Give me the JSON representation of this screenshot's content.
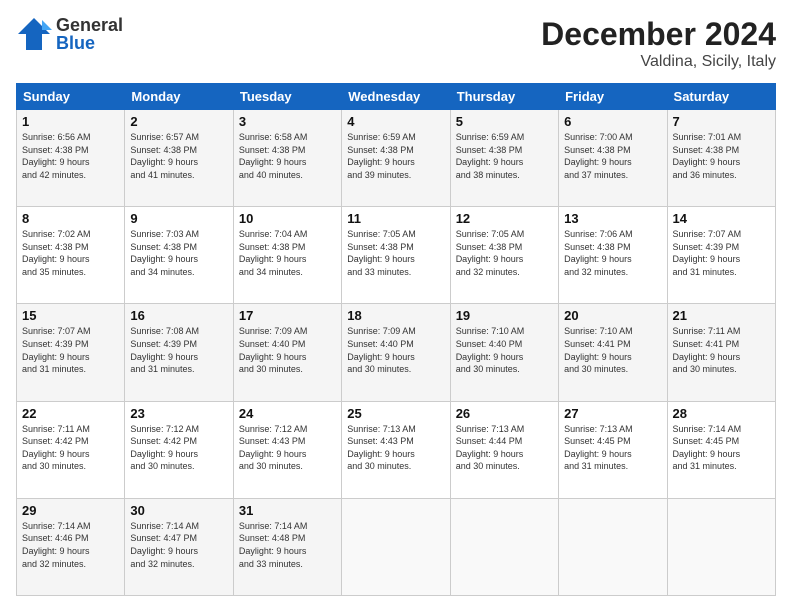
{
  "logo": {
    "general": "General",
    "blue": "Blue"
  },
  "title": "December 2024",
  "subtitle": "Valdina, Sicily, Italy",
  "days_header": [
    "Sunday",
    "Monday",
    "Tuesday",
    "Wednesday",
    "Thursday",
    "Friday",
    "Saturday"
  ],
  "weeks": [
    [
      {
        "day": "1",
        "info": "Sunrise: 6:56 AM\nSunset: 4:38 PM\nDaylight: 9 hours\nand 42 minutes."
      },
      {
        "day": "2",
        "info": "Sunrise: 6:57 AM\nSunset: 4:38 PM\nDaylight: 9 hours\nand 41 minutes."
      },
      {
        "day": "3",
        "info": "Sunrise: 6:58 AM\nSunset: 4:38 PM\nDaylight: 9 hours\nand 40 minutes."
      },
      {
        "day": "4",
        "info": "Sunrise: 6:59 AM\nSunset: 4:38 PM\nDaylight: 9 hours\nand 39 minutes."
      },
      {
        "day": "5",
        "info": "Sunrise: 6:59 AM\nSunset: 4:38 PM\nDaylight: 9 hours\nand 38 minutes."
      },
      {
        "day": "6",
        "info": "Sunrise: 7:00 AM\nSunset: 4:38 PM\nDaylight: 9 hours\nand 37 minutes."
      },
      {
        "day": "7",
        "info": "Sunrise: 7:01 AM\nSunset: 4:38 PM\nDaylight: 9 hours\nand 36 minutes."
      }
    ],
    [
      {
        "day": "8",
        "info": "Sunrise: 7:02 AM\nSunset: 4:38 PM\nDaylight: 9 hours\nand 35 minutes."
      },
      {
        "day": "9",
        "info": "Sunrise: 7:03 AM\nSunset: 4:38 PM\nDaylight: 9 hours\nand 34 minutes."
      },
      {
        "day": "10",
        "info": "Sunrise: 7:04 AM\nSunset: 4:38 PM\nDaylight: 9 hours\nand 34 minutes."
      },
      {
        "day": "11",
        "info": "Sunrise: 7:05 AM\nSunset: 4:38 PM\nDaylight: 9 hours\nand 33 minutes."
      },
      {
        "day": "12",
        "info": "Sunrise: 7:05 AM\nSunset: 4:38 PM\nDaylight: 9 hours\nand 32 minutes."
      },
      {
        "day": "13",
        "info": "Sunrise: 7:06 AM\nSunset: 4:38 PM\nDaylight: 9 hours\nand 32 minutes."
      },
      {
        "day": "14",
        "info": "Sunrise: 7:07 AM\nSunset: 4:39 PM\nDaylight: 9 hours\nand 31 minutes."
      }
    ],
    [
      {
        "day": "15",
        "info": "Sunrise: 7:07 AM\nSunset: 4:39 PM\nDaylight: 9 hours\nand 31 minutes."
      },
      {
        "day": "16",
        "info": "Sunrise: 7:08 AM\nSunset: 4:39 PM\nDaylight: 9 hours\nand 31 minutes."
      },
      {
        "day": "17",
        "info": "Sunrise: 7:09 AM\nSunset: 4:40 PM\nDaylight: 9 hours\nand 30 minutes."
      },
      {
        "day": "18",
        "info": "Sunrise: 7:09 AM\nSunset: 4:40 PM\nDaylight: 9 hours\nand 30 minutes."
      },
      {
        "day": "19",
        "info": "Sunrise: 7:10 AM\nSunset: 4:40 PM\nDaylight: 9 hours\nand 30 minutes."
      },
      {
        "day": "20",
        "info": "Sunrise: 7:10 AM\nSunset: 4:41 PM\nDaylight: 9 hours\nand 30 minutes."
      },
      {
        "day": "21",
        "info": "Sunrise: 7:11 AM\nSunset: 4:41 PM\nDaylight: 9 hours\nand 30 minutes."
      }
    ],
    [
      {
        "day": "22",
        "info": "Sunrise: 7:11 AM\nSunset: 4:42 PM\nDaylight: 9 hours\nand 30 minutes."
      },
      {
        "day": "23",
        "info": "Sunrise: 7:12 AM\nSunset: 4:42 PM\nDaylight: 9 hours\nand 30 minutes."
      },
      {
        "day": "24",
        "info": "Sunrise: 7:12 AM\nSunset: 4:43 PM\nDaylight: 9 hours\nand 30 minutes."
      },
      {
        "day": "25",
        "info": "Sunrise: 7:13 AM\nSunset: 4:43 PM\nDaylight: 9 hours\nand 30 minutes."
      },
      {
        "day": "26",
        "info": "Sunrise: 7:13 AM\nSunset: 4:44 PM\nDaylight: 9 hours\nand 30 minutes."
      },
      {
        "day": "27",
        "info": "Sunrise: 7:13 AM\nSunset: 4:45 PM\nDaylight: 9 hours\nand 31 minutes."
      },
      {
        "day": "28",
        "info": "Sunrise: 7:14 AM\nSunset: 4:45 PM\nDaylight: 9 hours\nand 31 minutes."
      }
    ],
    [
      {
        "day": "29",
        "info": "Sunrise: 7:14 AM\nSunset: 4:46 PM\nDaylight: 9 hours\nand 32 minutes."
      },
      {
        "day": "30",
        "info": "Sunrise: 7:14 AM\nSunset: 4:47 PM\nDaylight: 9 hours\nand 32 minutes."
      },
      {
        "day": "31",
        "info": "Sunrise: 7:14 AM\nSunset: 4:48 PM\nDaylight: 9 hours\nand 33 minutes."
      },
      {
        "day": "",
        "info": ""
      },
      {
        "day": "",
        "info": ""
      },
      {
        "day": "",
        "info": ""
      },
      {
        "day": "",
        "info": ""
      }
    ]
  ]
}
